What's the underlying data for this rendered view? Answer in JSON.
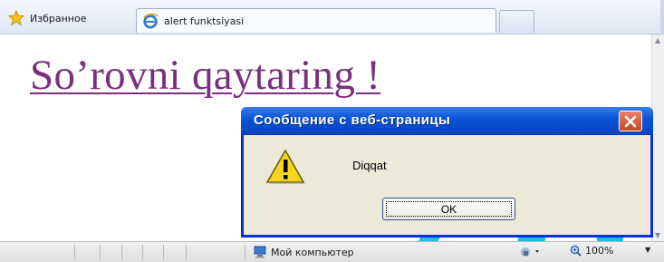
{
  "favorites": {
    "label": "Избранное",
    "icon": "star-icon"
  },
  "tabs": [
    {
      "label": "alert funktsiyasi",
      "icon": "ie-icon",
      "active": true
    },
    {
      "label": "",
      "icon": "",
      "active": false
    }
  ],
  "page": {
    "heading": "So’rovni qaytaring !",
    "heading_color": "#7a2f7f"
  },
  "dialog": {
    "title": "Сообщение с веб-страницы",
    "message": "Diqqat",
    "ok_label": "OK",
    "icon": "warning-icon",
    "close_icon": "close-icon"
  },
  "statusbar": {
    "zone_label": "Мой компьютер",
    "zone_icon": "computer-icon",
    "zoom_label": "100%",
    "zoom_icon": "zoom-icon"
  },
  "colors": {
    "title_bar": "#0a55d7",
    "dialog_bg": "#ece9d8",
    "accent_cyan": "#00b5d8"
  }
}
